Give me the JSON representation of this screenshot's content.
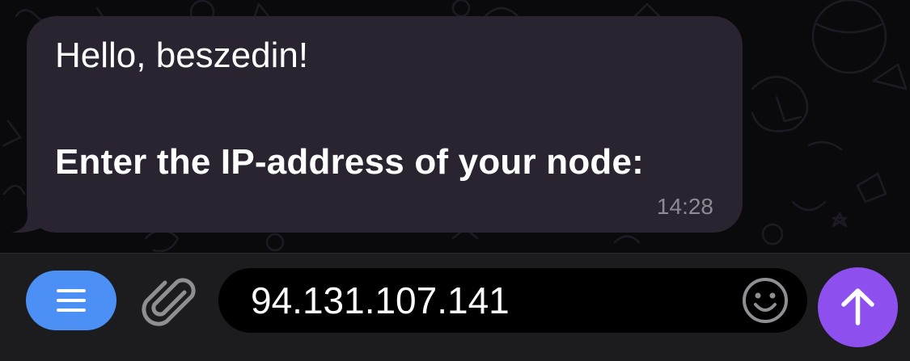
{
  "message": {
    "greeting": "Hello, beszedin!",
    "prompt": "Enter the IP-address of your node:",
    "time": "14:28"
  },
  "input": {
    "value": "94.131.107.141"
  },
  "icons": {
    "menu": "menu-icon",
    "attach": "paperclip-icon",
    "emoji": "smiley-icon",
    "send": "arrow-up-icon"
  },
  "colors": {
    "bubble": "#2a2330",
    "menu_button": "#4c8ff5",
    "send_button": "#8e4fef",
    "input_bar": "#1c1c1e"
  }
}
